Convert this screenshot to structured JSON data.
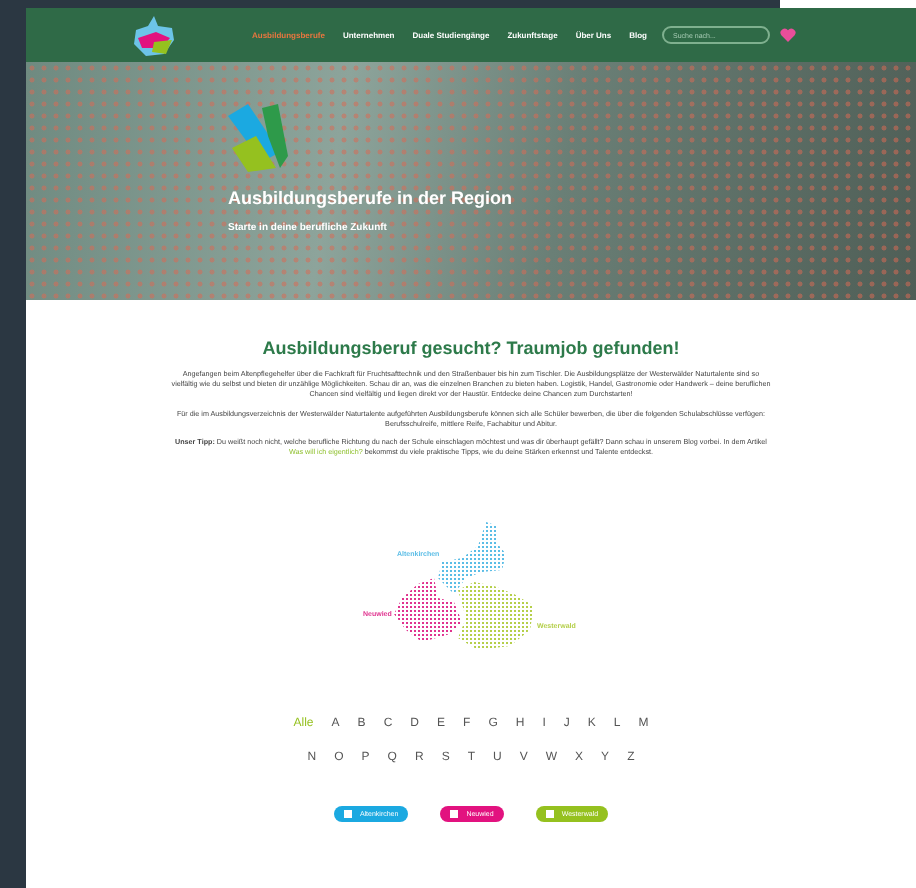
{
  "header": {
    "nav": [
      {
        "label": "Ausbildungsberufe",
        "selected": true
      },
      {
        "label": "Unternehmen",
        "selected": false
      },
      {
        "label": "Duale Studiengänge",
        "selected": false
      },
      {
        "label": "Zukunftstage",
        "selected": false
      },
      {
        "label": "Über Uns",
        "selected": false
      },
      {
        "label": "Blog",
        "selected": false
      }
    ],
    "search": {
      "placeholder": "Suche nach..."
    }
  },
  "hero": {
    "title": "Ausbildungsberufe in der Region",
    "subtitle": "Starte in deine berufliche Zukunft"
  },
  "intro": {
    "heading": "Ausbildungsberuf gesucht? Traumjob gefunden!",
    "paragraphs": [
      {
        "text": "Angefangen beim Altenpflegehelfer über die Fachkraft für Fruchtsafttechnik und den Straßenbauer bis hin zum Tischler. Die Ausbildungsplätze der Westerwälder Naturtalente sind so vielfältig wie du selbst und bieten dir unzählige Möglichkeiten. Schau dir an, was die einzelnen Branchen zu bieten haben. Logistik, Handel, Gastronomie oder Handwerk – deine beruflichen Chancen sind vielfältig und liegen direkt vor der Haustür. Entdecke deine Chancen zum Durchstarten!"
      },
      {
        "text": "Für die im Ausbildungsverzeichnis der Westerwälder Naturtalente aufgeführten Ausbildungsberufe können sich alle Schüler bewerben, die über die folgenden Schulabschlüsse verfügen: Berufsschulreife, mittlere Reife, Fachabitur und Abitur."
      },
      {
        "text": "**Unser Tipp:** Du weißt noch nicht, welche berufliche Richtung du nach der Schule einschlagen möchtest und was dir überhaupt gefällt? Dann schau in unserem Blog vorbei. In dem Artikel",
        "link": "Was will ich eigentlich?",
        "after": "bekommst du viele praktische Tipps, wie du deine Stärken erkennst und Talente entdeckst."
      }
    ]
  },
  "map": {
    "regions": [
      {
        "name": "Altenkirchen",
        "color": "#5bbde6"
      },
      {
        "name": "Neuwied",
        "color": "#e0338f"
      },
      {
        "name": "Westerwald",
        "color": "#b5cf4a"
      }
    ]
  },
  "alphabet": [
    {
      "label": "Alle",
      "selected": true
    },
    {
      "label": "A",
      "selected": false
    },
    {
      "label": "B",
      "selected": false
    },
    {
      "label": "C",
      "selected": false
    },
    {
      "label": "D",
      "selected": false
    },
    {
      "label": "E",
      "selected": false
    },
    {
      "label": "F",
      "selected": false
    },
    {
      "label": "G",
      "selected": false
    },
    {
      "label": "H",
      "selected": false
    },
    {
      "label": "I",
      "selected": false
    },
    {
      "label": "J",
      "selected": false
    },
    {
      "label": "K",
      "selected": false
    },
    {
      "label": "L",
      "selected": false
    },
    {
      "label": "M",
      "selected": false
    },
    {
      "label": "N",
      "selected": false
    },
    {
      "label": "O",
      "selected": false
    },
    {
      "label": "P",
      "selected": false
    },
    {
      "label": "Q",
      "selected": false
    },
    {
      "label": "R",
      "selected": false
    },
    {
      "label": "S",
      "selected": false
    },
    {
      "label": "T",
      "selected": false
    },
    {
      "label": "U",
      "selected": false
    },
    {
      "label": "V",
      "selected": false
    },
    {
      "label": "W",
      "selected": false
    },
    {
      "label": "X",
      "selected": false
    },
    {
      "label": "Y",
      "selected": false
    },
    {
      "label": "Z",
      "selected": false
    }
  ],
  "filters": [
    {
      "label": "Altenkirchen",
      "color": "#1ba9e1",
      "checked": false
    },
    {
      "label": "Neuwied",
      "color": "#e2127f",
      "checked": false
    },
    {
      "label": "Westerwald",
      "color": "#95c11f",
      "checked": false
    }
  ]
}
